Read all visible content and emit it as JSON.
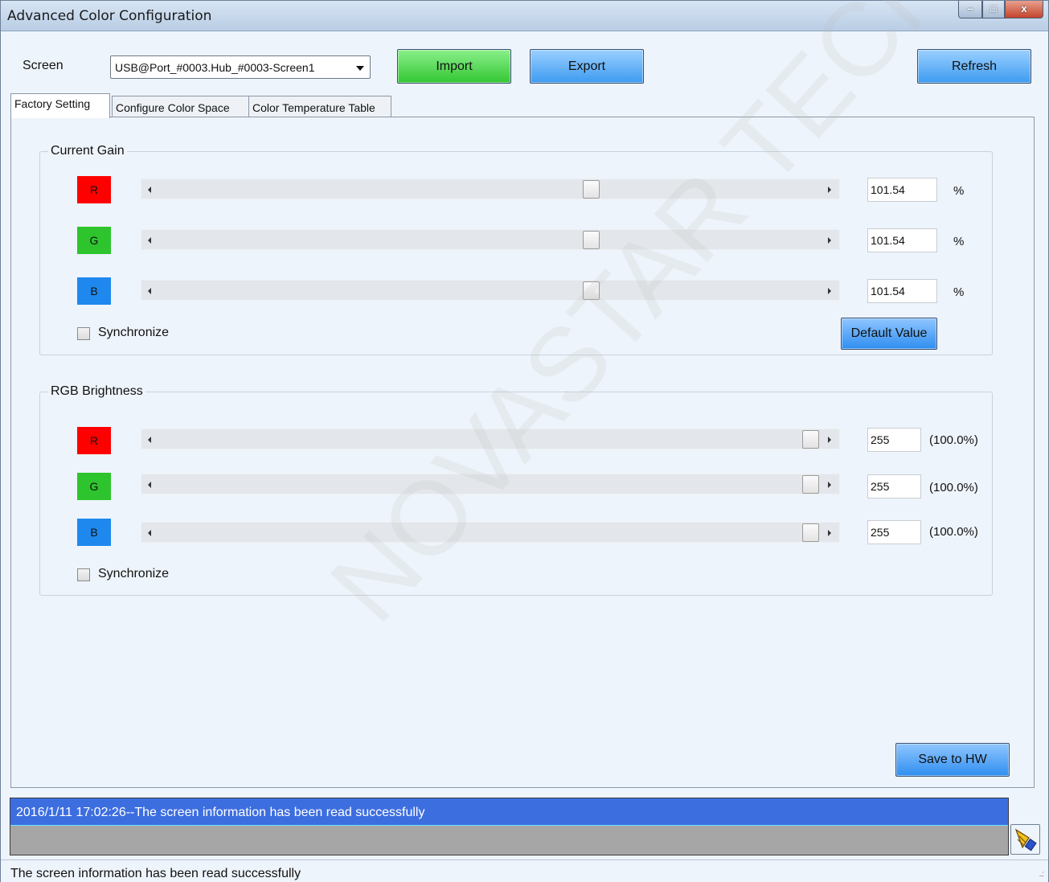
{
  "window": {
    "title": "Advanced Color Configuration",
    "minimize_glyph": "–",
    "maximize_glyph": "□",
    "close_glyph": "x"
  },
  "toolbar": {
    "screen_label": "Screen",
    "screen_value": "USB@Port_#0003.Hub_#0003-Screen1",
    "import_label": "Import",
    "export_label": "Export",
    "refresh_label": "Refresh"
  },
  "tabs": [
    {
      "label": "Factory Setting",
      "active": true
    },
    {
      "label": "Configure Color Space",
      "active": false
    },
    {
      "label": "Color Temperature Table",
      "active": false
    }
  ],
  "current_gain": {
    "title": "Current Gain",
    "rows": [
      {
        "channel": "R",
        "color": "#ff0000",
        "value": "101.54",
        "unit": "%",
        "level": 0.66
      },
      {
        "channel": "G",
        "color": "#2ec42e",
        "value": "101.54",
        "unit": "%",
        "level": 0.66
      },
      {
        "channel": "B",
        "color": "#1e88ee",
        "value": "101.54",
        "unit": "%",
        "level": 0.66
      }
    ],
    "sync_label": "Synchronize",
    "sync_checked": false,
    "default_label": "Default Value"
  },
  "rgb_brightness": {
    "title": "RGB Brightness",
    "rows": [
      {
        "channel": "R",
        "color": "#ff0000",
        "value": "255",
        "percent": "(100.0%)",
        "level": 1.0
      },
      {
        "channel": "G",
        "color": "#2ec42e",
        "value": "255",
        "percent": "(100.0%)",
        "level": 1.0
      },
      {
        "channel": "B",
        "color": "#1e88ee",
        "value": "255",
        "percent": "(100.0%)",
        "level": 1.0
      }
    ],
    "sync_label": "Synchronize",
    "sync_checked": false
  },
  "save_label": "Save to HW",
  "log": {
    "entry": "2016/1/11 17:02:26--The screen information has been read successfully"
  },
  "status": {
    "text": "The screen information has been read successfully",
    "grip": "..:"
  },
  "watermark": "NOVASTAR TECH CO.,LT"
}
